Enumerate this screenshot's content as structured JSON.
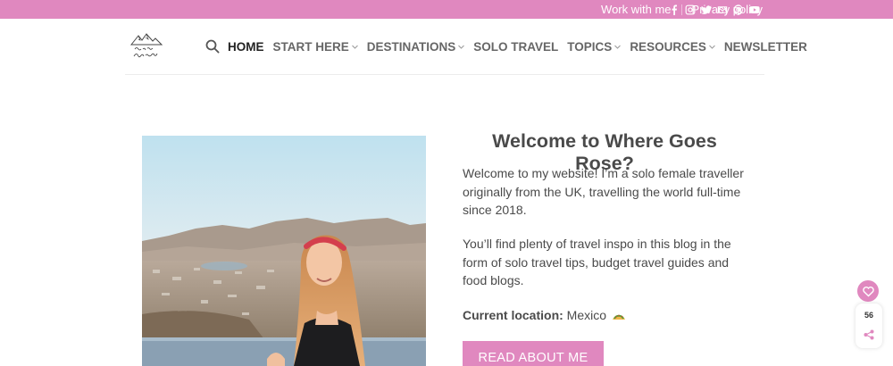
{
  "colors": {
    "brand_pink": "#e088bf",
    "text": "#4a4a4a",
    "nav": "#666666",
    "nav_active": "#222222"
  },
  "topbar": {
    "links": [
      {
        "label": "Work with me"
      },
      {
        "label": "Privacy policy"
      }
    ],
    "socials": [
      "facebook-icon",
      "instagram-icon",
      "twitter-icon",
      "email-icon",
      "pinterest-icon",
      "youtube-icon"
    ]
  },
  "header": {
    "nav": [
      {
        "label": "HOME",
        "active": true,
        "dropdown": false
      },
      {
        "label": "START HERE",
        "active": false,
        "dropdown": true
      },
      {
        "label": "DESTINATIONS",
        "active": false,
        "dropdown": true
      },
      {
        "label": "SOLO TRAVEL",
        "active": false,
        "dropdown": false
      },
      {
        "label": "TOPICS",
        "active": false,
        "dropdown": true
      },
      {
        "label": "RESOURCES",
        "active": false,
        "dropdown": true
      },
      {
        "label": "NEWSLETTER",
        "active": false,
        "dropdown": false
      }
    ]
  },
  "hero": {
    "title": "Welcome to Where Goes Rose?",
    "paragraph1": "Welcome to my website! I’m a solo female traveller originally from the UK, travelling the world full-time since 2018.",
    "paragraph2": "You’ll find plenty of travel inspo in this blog in the form of solo travel tips, budget travel guides and food blogs.",
    "location_label": "Current location:",
    "location_value": "Mexico",
    "button_label": "READ ABOUT ME"
  },
  "share": {
    "count": "56"
  }
}
